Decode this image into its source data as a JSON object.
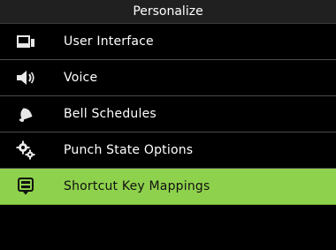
{
  "header": {
    "title": "Personalize"
  },
  "menu": {
    "items": [
      {
        "label": "User Interface",
        "icon": "display-icon"
      },
      {
        "label": "Voice",
        "icon": "speaker-icon"
      },
      {
        "label": "Bell Schedules",
        "icon": "bell-icon"
      },
      {
        "label": "Punch State Options",
        "icon": "gears-icon"
      },
      {
        "label": "Shortcut Key Mappings",
        "icon": "keypad-icon",
        "selected": true
      }
    ]
  },
  "colors": {
    "background": "#000000",
    "selected_row": "#8ed14c",
    "text": "#ffffff",
    "divider": "#4a4a4a"
  }
}
